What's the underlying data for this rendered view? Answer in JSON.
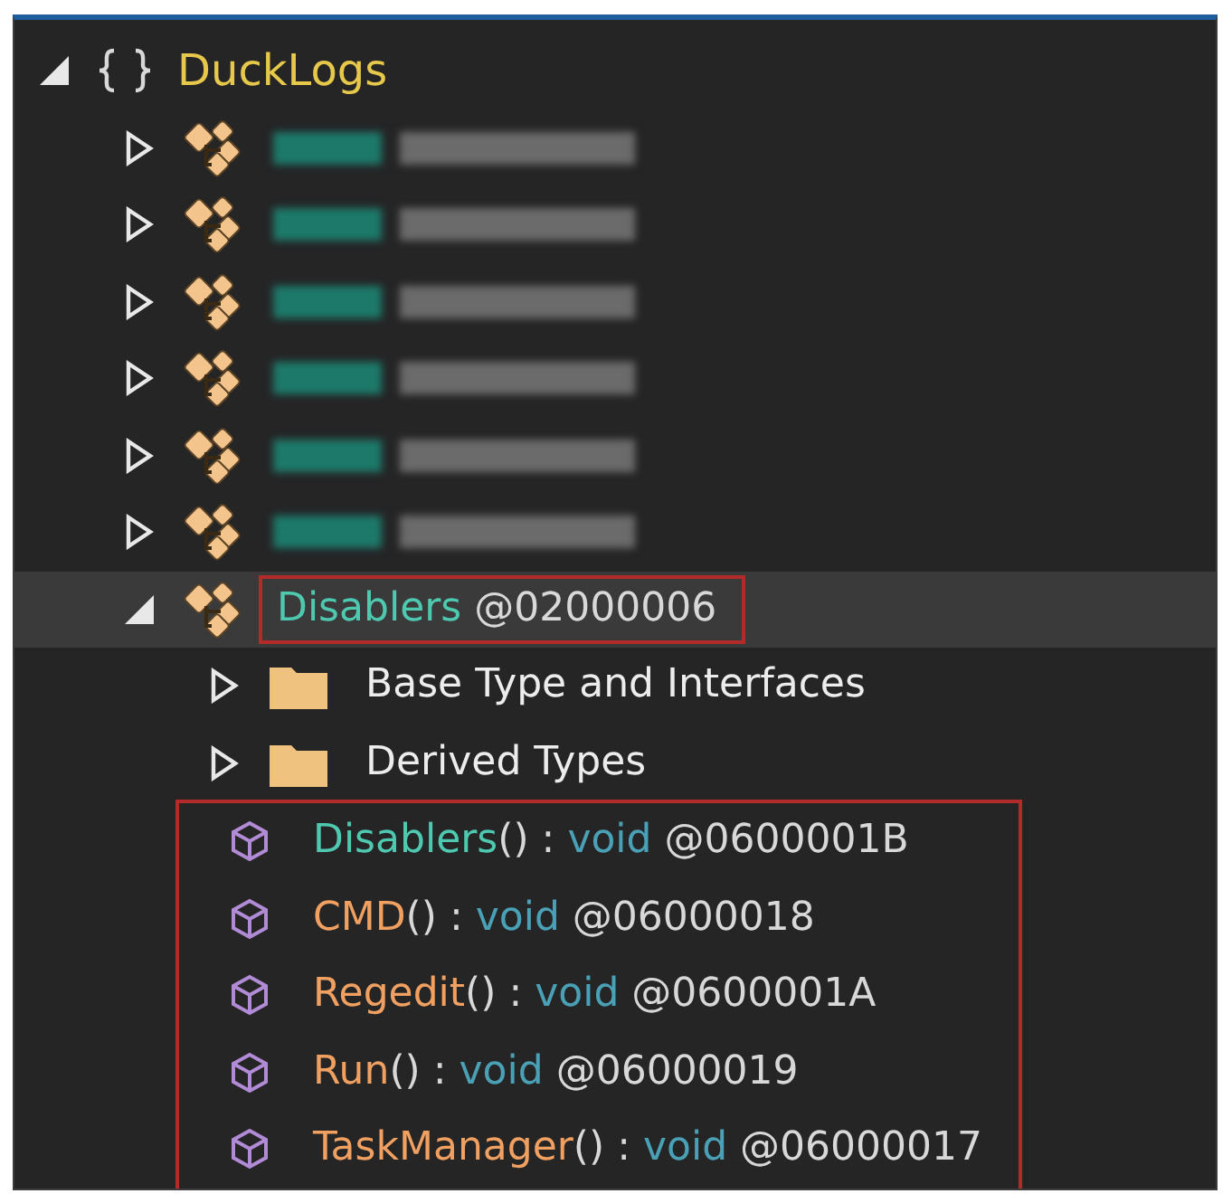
{
  "tree": {
    "label": "DuckLogs",
    "expanded": true,
    "children": [
      {
        "kind": "redacted",
        "expanded": false
      },
      {
        "kind": "redacted",
        "expanded": false
      },
      {
        "kind": "redacted",
        "expanded": false
      },
      {
        "kind": "redacted",
        "expanded": false
      },
      {
        "kind": "redacted",
        "expanded": false
      },
      {
        "kind": "redacted",
        "expanded": false
      },
      {
        "kind": "class",
        "label": "Disablers",
        "token": "@02000006",
        "expanded": true,
        "selected": true,
        "highlighted": true,
        "members_highlighted": true,
        "children": [
          {
            "kind": "folder",
            "label": "Base Type and Interfaces",
            "expanded": false
          },
          {
            "kind": "folder",
            "label": "Derived Types",
            "expanded": false
          }
        ],
        "members": [
          {
            "kind": "constructor",
            "name": "Disablers",
            "signature": "() : ",
            "return_type": "void",
            "token": "@0600001B"
          },
          {
            "kind": "method",
            "name": "CMD",
            "signature": "() : ",
            "return_type": "void",
            "token": "@06000018"
          },
          {
            "kind": "method",
            "name": "Regedit",
            "signature": "() : ",
            "return_type": "void",
            "token": "@0600001A"
          },
          {
            "kind": "method",
            "name": "Run",
            "signature": "() : ",
            "return_type": "void",
            "token": "@06000019"
          },
          {
            "kind": "method",
            "name": "TaskManager",
            "signature": "() : ",
            "return_type": "void",
            "token": "@06000017"
          }
        ]
      }
    ]
  }
}
